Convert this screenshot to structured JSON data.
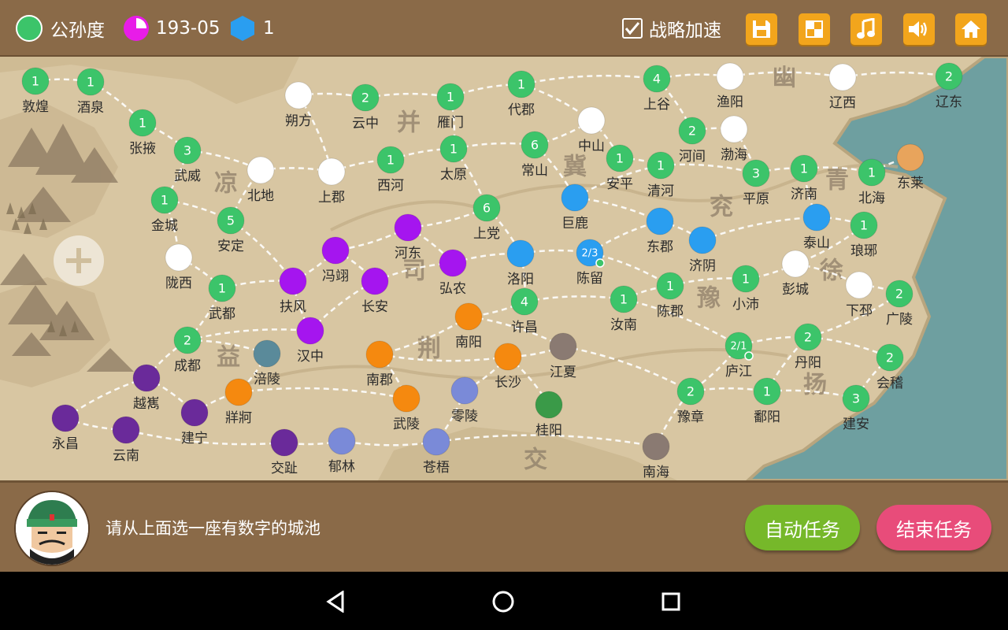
{
  "header": {
    "ruler_name": "公孙度",
    "ruler_color": "#3cc46a",
    "date": "193-05",
    "date_icon_color": "#e81ce8",
    "resource_value": "1",
    "resource_icon_color": "#2a9ef0",
    "fast_strategy_label": "战略加速",
    "fast_strategy_checked": true,
    "buttons": [
      "save-icon",
      "map-toggle-icon",
      "music-icon",
      "sound-icon",
      "home-icon"
    ]
  },
  "map": {
    "region_labels": [
      "幽",
      "并",
      "凉",
      "冀",
      "青",
      "兖",
      "徐",
      "司",
      "豫",
      "益",
      "荆",
      "扬",
      "交"
    ],
    "cities": [
      {
        "name": "敦煌",
        "badge": "1",
        "color": "#3cc46a"
      },
      {
        "name": "酒泉",
        "badge": "1",
        "color": "#3cc46a"
      },
      {
        "name": "张掖",
        "badge": "1",
        "color": "#3cc46a"
      },
      {
        "name": "武威",
        "badge": "3",
        "color": "#3cc46a"
      },
      {
        "name": "金城",
        "badge": "1",
        "color": "#3cc46a"
      },
      {
        "name": "安定",
        "badge": "5",
        "color": "#3cc46a"
      },
      {
        "name": "北地",
        "badge": "",
        "color": "#ffffff"
      },
      {
        "name": "朔方",
        "badge": "",
        "color": "#ffffff"
      },
      {
        "name": "上郡",
        "badge": "",
        "color": "#ffffff"
      },
      {
        "name": "云中",
        "badge": "2",
        "color": "#3cc46a"
      },
      {
        "name": "西河",
        "badge": "1",
        "color": "#3cc46a"
      },
      {
        "name": "雁门",
        "badge": "1",
        "color": "#3cc46a"
      },
      {
        "name": "太原",
        "badge": "1",
        "color": "#3cc46a"
      },
      {
        "name": "代郡",
        "badge": "1",
        "color": "#3cc46a"
      },
      {
        "name": "上谷",
        "badge": "4",
        "color": "#3cc46a"
      },
      {
        "name": "渔阳",
        "badge": "",
        "color": "#ffffff"
      },
      {
        "name": "辽西",
        "badge": "",
        "color": "#ffffff"
      },
      {
        "name": "辽东",
        "badge": "2",
        "color": "#3cc46a"
      },
      {
        "name": "中山",
        "badge": "",
        "color": "#ffffff"
      },
      {
        "name": "常山",
        "badge": "6",
        "color": "#3cc46a"
      },
      {
        "name": "安平",
        "badge": "1",
        "color": "#3cc46a"
      },
      {
        "name": "河间",
        "badge": "2",
        "color": "#3cc46a"
      },
      {
        "name": "渤海",
        "badge": "",
        "color": "#ffffff"
      },
      {
        "name": "清河",
        "badge": "1",
        "color": "#3cc46a"
      },
      {
        "name": "平原",
        "badge": "3",
        "color": "#3cc46a"
      },
      {
        "name": "济南",
        "badge": "1",
        "color": "#3cc46a"
      },
      {
        "name": "北海",
        "badge": "1",
        "color": "#3cc46a"
      },
      {
        "name": "东莱",
        "badge": "",
        "color": "#e8a45c"
      },
      {
        "name": "陇西",
        "badge": "",
        "color": "#ffffff"
      },
      {
        "name": "武都",
        "badge": "1",
        "color": "#3cc46a"
      },
      {
        "name": "扶风",
        "badge": "",
        "color": "#a515ef"
      },
      {
        "name": "冯翊",
        "badge": "",
        "color": "#a515ef"
      },
      {
        "name": "长安",
        "badge": "",
        "color": "#a515ef"
      },
      {
        "name": "河东",
        "badge": "",
        "color": "#a515ef"
      },
      {
        "name": "弘农",
        "badge": "",
        "color": "#a515ef"
      },
      {
        "name": "上党",
        "badge": "6",
        "color": "#3cc46a"
      },
      {
        "name": "巨鹿",
        "badge": "",
        "color": "#2a9ef0"
      },
      {
        "name": "洛阳",
        "badge": "",
        "color": "#2a9ef0"
      },
      {
        "name": "陈留",
        "badge": "2/3",
        "color": "#2a9ef0",
        "marker": true
      },
      {
        "name": "东郡",
        "badge": "",
        "color": "#2a9ef0"
      },
      {
        "name": "济阴",
        "badge": "",
        "color": "#2a9ef0"
      },
      {
        "name": "泰山",
        "badge": "",
        "color": "#2a9ef0"
      },
      {
        "name": "琅琊",
        "badge": "1",
        "color": "#3cc46a"
      },
      {
        "name": "许昌",
        "badge": "4",
        "color": "#3cc46a"
      },
      {
        "name": "汝南",
        "badge": "1",
        "color": "#3cc46a"
      },
      {
        "name": "陈郡",
        "badge": "1",
        "color": "#3cc46a"
      },
      {
        "name": "小沛",
        "badge": "1",
        "color": "#3cc46a"
      },
      {
        "name": "彭城",
        "badge": "",
        "color": "#ffffff"
      },
      {
        "name": "下邳",
        "badge": "",
        "color": "#ffffff"
      },
      {
        "name": "广陵",
        "badge": "2",
        "color": "#3cc46a"
      },
      {
        "name": "成都",
        "badge": "2",
        "color": "#3cc46a"
      },
      {
        "name": "汉中",
        "badge": "",
        "color": "#a515ef"
      },
      {
        "name": "涪陵",
        "badge": "",
        "color": "#5a8a9a"
      },
      {
        "name": "南阳",
        "badge": "",
        "color": "#f5890f"
      },
      {
        "name": "南郡",
        "badge": "",
        "color": "#f5890f"
      },
      {
        "name": "长沙",
        "badge": "",
        "color": "#f5890f"
      },
      {
        "name": "江夏",
        "badge": "",
        "color": "#8a7a72"
      },
      {
        "name": "庐江",
        "badge": "2/1",
        "color": "#3cc46a",
        "marker": true
      },
      {
        "name": "丹阳",
        "badge": "2",
        "color": "#3cc46a"
      },
      {
        "name": "会稽",
        "badge": "2",
        "color": "#3cc46a"
      },
      {
        "name": "越嶲",
        "badge": "",
        "color": "#6a2a9a"
      },
      {
        "name": "牂牁",
        "badge": "",
        "color": "#f5890f"
      },
      {
        "name": "建宁",
        "badge": "",
        "color": "#6a2a9a"
      },
      {
        "name": "永昌",
        "badge": "",
        "color": "#6a2a9a"
      },
      {
        "name": "云南",
        "badge": "",
        "color": "#6a2a9a"
      },
      {
        "name": "武陵",
        "badge": "",
        "color": "#f5890f"
      },
      {
        "name": "零陵",
        "badge": "",
        "color": "#7a8ad8"
      },
      {
        "name": "桂阳",
        "badge": "",
        "color": "#3a9a48"
      },
      {
        "name": "豫章",
        "badge": "2",
        "color": "#3cc46a"
      },
      {
        "name": "鄱阳",
        "badge": "1",
        "color": "#3cc46a"
      },
      {
        "name": "建安",
        "badge": "3",
        "color": "#3cc46a"
      },
      {
        "name": "交趾",
        "badge": "",
        "color": "#6a2a9a"
      },
      {
        "name": "郁林",
        "badge": "",
        "color": "#7a8ad8"
      },
      {
        "name": "苍梧",
        "badge": "",
        "color": "#7a8ad8"
      },
      {
        "name": "南海",
        "badge": "",
        "color": "#8a7a72"
      }
    ]
  },
  "footer": {
    "prompt": "请从上面选一座有数字的城池",
    "auto_task_label": "自动任务",
    "auto_task_color": "#76b82a",
    "end_task_label": "结束任务",
    "end_task_color": "#e84c7a"
  }
}
